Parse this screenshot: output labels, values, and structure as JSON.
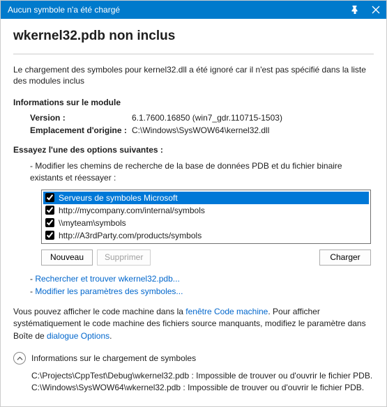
{
  "titlebar": {
    "text": "Aucun symbole n'a été chargé"
  },
  "heading": "wkernel32.pdb non inclus",
  "description": "Le chargement des symboles pour kernel32.dll a été ignoré car il n'est pas spécifié dans la liste des modules inclus",
  "module_info": {
    "title": "Informations sur le module",
    "version_label": "Version :",
    "version_value": "6.1.7600.16850 (win7_gdr.110715-1503)",
    "origin_label": "Emplacement d'origine :",
    "origin_value": "C:\\Windows\\SysWOW64\\kernel32.dll"
  },
  "options": {
    "title": "Essayez l'une des options suivantes :",
    "modify_paths": "- Modifier les chemins de recherche de la base de données PDB et du fichier binaire existants et réessayer :",
    "list": [
      {
        "label": "Serveurs de symboles Microsoft",
        "checked": true,
        "selected": true
      },
      {
        "label": "http://mycompany.com/internal/symbols",
        "checked": true,
        "selected": false
      },
      {
        "label": "\\\\myteam\\symbols",
        "checked": true,
        "selected": false
      },
      {
        "label": "http://A3rdParty.com/products/symbols",
        "checked": true,
        "selected": false
      }
    ],
    "new_btn": "Nouveau",
    "delete_btn": "Supprimer",
    "load_btn": "Charger"
  },
  "links": {
    "find": "Rechercher et trouver wkernel32.pdb...",
    "modify": "Modifier les paramètres des symboles..."
  },
  "footer": {
    "p1": "Vous pouvez afficher le code machine dans la ",
    "link1": "fenêtre Code machine",
    "p2": ". Pour afficher systématiquement le code machine des fichiers source manquants, modifiez le paramètre dans Boîte de ",
    "link2": "dialogue Options",
    "p3": "."
  },
  "load_info": {
    "title": "Informations sur le chargement de symboles",
    "line1": "C:\\Projects\\CppTest\\Debug\\wkernel32.pdb : Impossible de trouver ou d'ouvrir le fichier PDB.",
    "line2": "C:\\Windows\\SysWOW64\\wkernel32.pdb : Impossible de trouver ou d'ouvrir le fichier PDB."
  }
}
